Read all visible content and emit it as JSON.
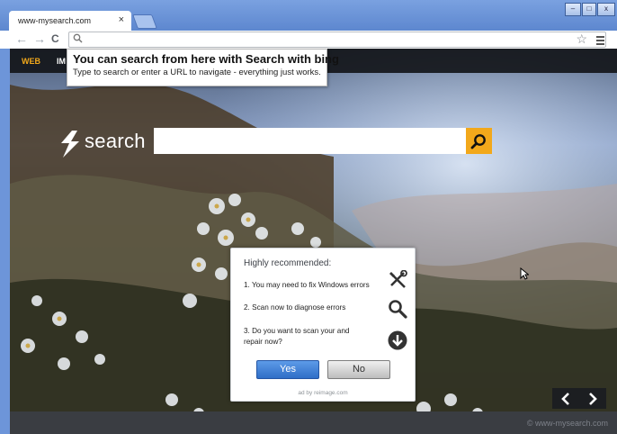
{
  "browser": {
    "tab_title": "www-mysearch.com",
    "tab_close": "×",
    "address_value": "",
    "window_buttons": {
      "minimize": "–",
      "maximize": "□",
      "close": "x"
    },
    "back_glyph": "←",
    "forward_glyph": "→",
    "reload_glyph": "C",
    "star_glyph": "☆"
  },
  "nav": {
    "items": [
      {
        "label": "WEB",
        "active": true
      },
      {
        "label": "IM",
        "active": false
      }
    ]
  },
  "tooltip": {
    "title": "You can search from here with Search with bing",
    "text": "Type to search or enter a URL to navigate - everything just works."
  },
  "search": {
    "logo_text": "search",
    "input_value": "",
    "button_icon": "search-icon"
  },
  "ad": {
    "heading": "Highly recommended:",
    "items": [
      {
        "text": "1. You may need to fix Windows errors",
        "icon": "tools-icon"
      },
      {
        "text": "2. Scan now to diagnose errors",
        "icon": "magnifier-icon"
      },
      {
        "text": "3. Do you want to scan your and repair now?",
        "icon": "download-icon"
      }
    ],
    "yes_label": "Yes",
    "no_label": "No",
    "footer": "ad by reimage.com"
  },
  "slider": {
    "prev_icon": "chevron-left-icon",
    "next_icon": "chevron-right-icon"
  },
  "footer": {
    "copyright": "© www-mysearch.com"
  },
  "colors": {
    "accent": "#f2a81b",
    "frame": "#6d95d9",
    "navbar": "#14161a",
    "yes_button": "#3b7fd8"
  }
}
